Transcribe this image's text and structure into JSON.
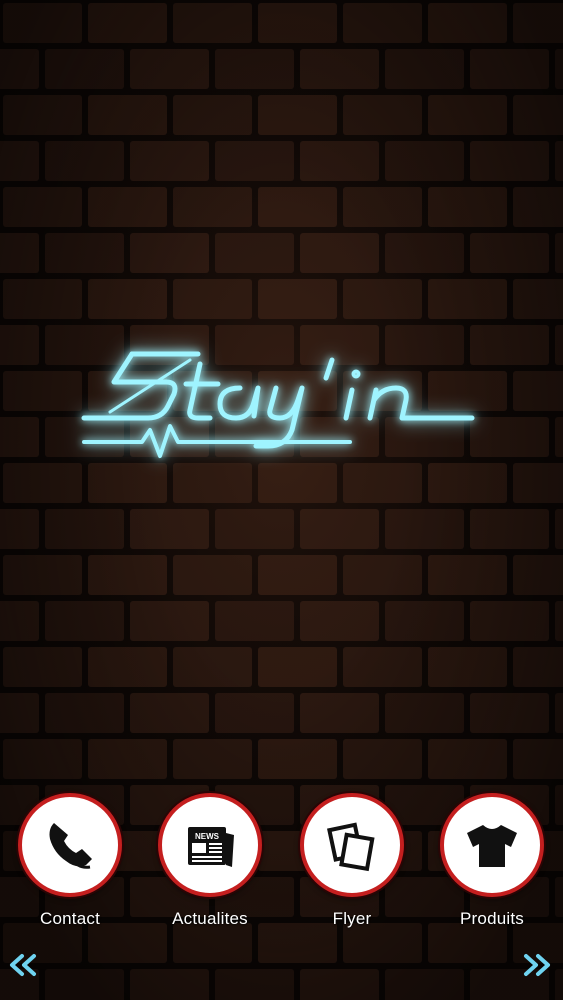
{
  "brand": {
    "logo_text": "Stay'in",
    "neon_color": "#9ff4ff",
    "glow_color": "#35c8e0"
  },
  "nav": {
    "items": [
      {
        "label": "Contact",
        "icon": "phone-icon"
      },
      {
        "label": "Actualites",
        "icon": "newspaper-icon",
        "icon_text": "NEWS"
      },
      {
        "label": "Flyer",
        "icon": "flyer-icon"
      },
      {
        "label": "Produits",
        "icon": "tshirt-icon"
      }
    ],
    "ring_color": "#c41f1f"
  },
  "pager": {
    "prev_icon": "double-chevron-left-icon",
    "next_icon": "double-chevron-right-icon",
    "arrow_color": "#6fd3f0"
  }
}
